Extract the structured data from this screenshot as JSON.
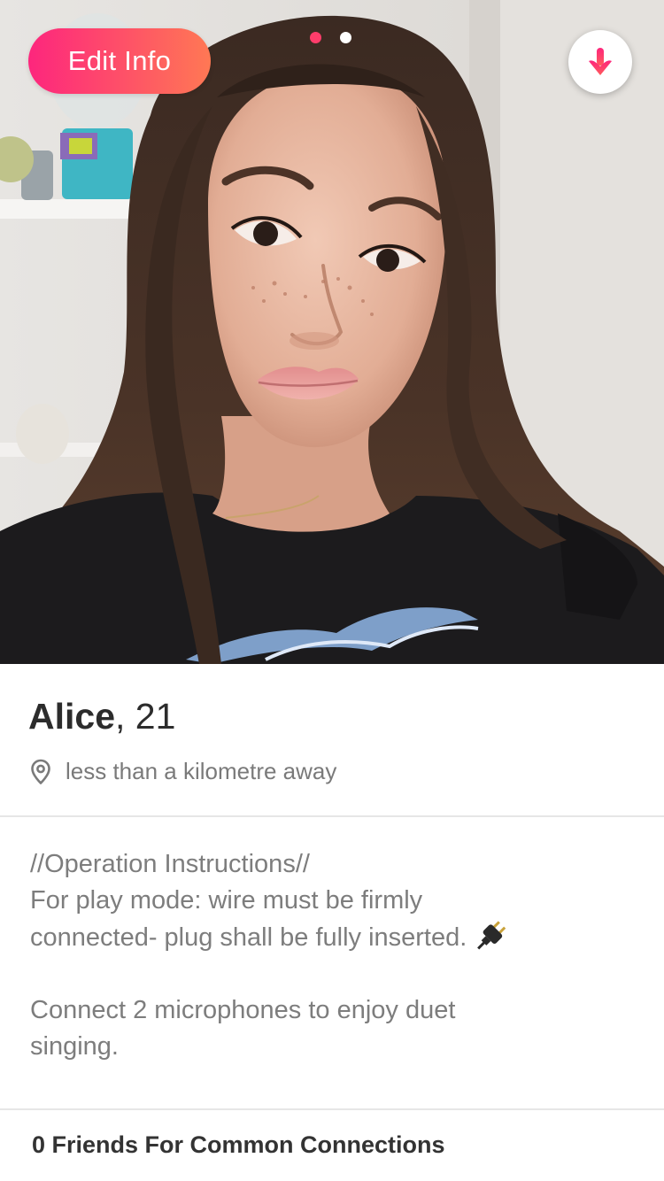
{
  "photo_header": {
    "edit_button_label": "Edit Info",
    "photo_count": 2,
    "active_photo_index": 0,
    "collapse_icon": "arrow-down-icon"
  },
  "profile": {
    "name": "Alice",
    "age_text": ", 21",
    "location_icon": "location-pin-icon",
    "distance": "less than a kilometre away"
  },
  "bio": {
    "line1": "//Operation Instructions//",
    "line2": "For play mode: wire must be firmly",
    "line3": "connected- plug shall be fully inserted.",
    "line3_emoji": "electric-plug-emoji",
    "line4": "Connect 2 microphones to enjoy duet",
    "line5": "singing."
  },
  "connections": {
    "label": "0 Friends For Common Connections"
  },
  "colors": {
    "brand_gradient_start": "#fd267d",
    "brand_gradient_end": "#ff7854",
    "active_dot": "#fd3d6b",
    "arrow_gradient_start": "#fd267d",
    "arrow_gradient_end": "#ff7854"
  }
}
